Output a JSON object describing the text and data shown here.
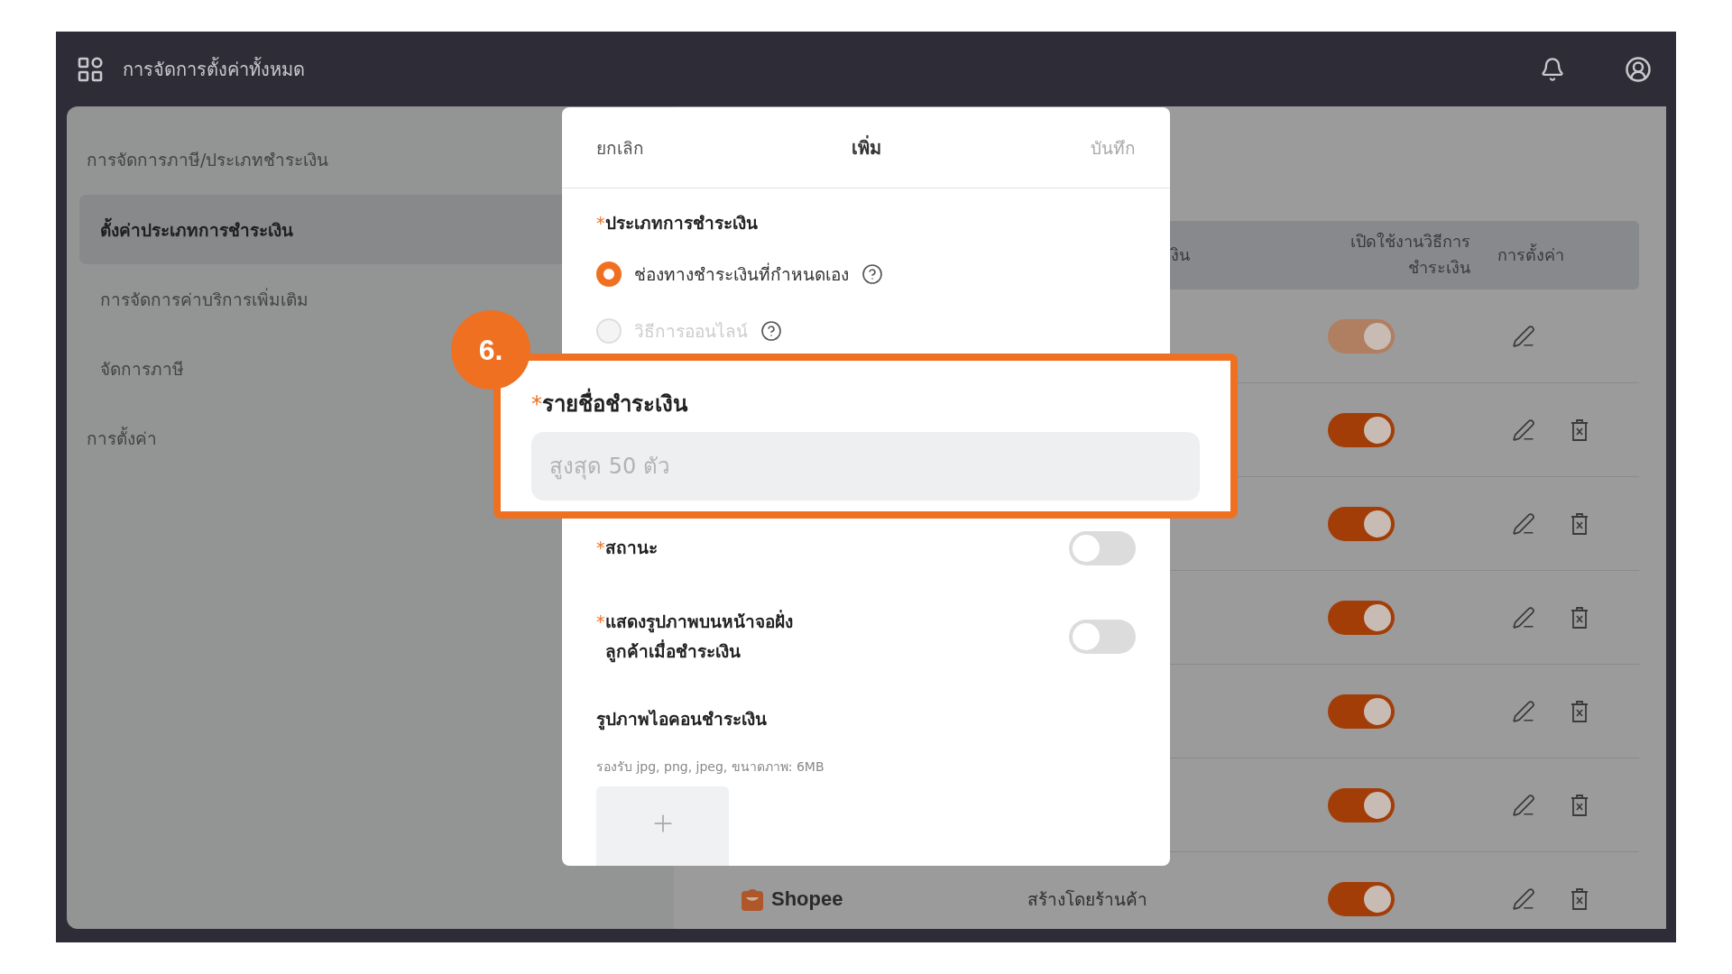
{
  "top_bar": {
    "title": "การจัดการตั้งค่าทั้งหมด"
  },
  "sidebar": {
    "groups": [
      {
        "label": "การจัดการภาษี/ประเภทชำระเงิน",
        "children": [
          {
            "label": "ตั้งค่าประเภทการชำระเงิน",
            "selected": true
          },
          {
            "label": "การจัดการค่าบริการเพิ่มเติม",
            "selected": false
          },
          {
            "label": "จัดการภาษี",
            "selected": false
          }
        ]
      },
      {
        "label": "การตั้งค่า"
      }
    ]
  },
  "table": {
    "columns": [
      {
        "label": "งิน"
      },
      {
        "label": "เปิดใช้งานวิธีการ ชำระเงิน"
      },
      {
        "label": "การตั้งค่า"
      }
    ],
    "rows": [
      {
        "enabled": true,
        "disabled": true,
        "deletable": false
      },
      {
        "enabled": true,
        "disabled": false,
        "deletable": true
      },
      {
        "enabled": true,
        "disabled": false,
        "deletable": true
      },
      {
        "enabled": true,
        "disabled": false,
        "deletable": true
      },
      {
        "enabled": true,
        "disabled": false,
        "deletable": true
      },
      {
        "enabled": true,
        "disabled": false,
        "deletable": true
      },
      {
        "name": "Shopee",
        "created_by": "สร้างโดยร้านค้า",
        "enabled": true,
        "disabled": false,
        "deletable": true
      }
    ]
  },
  "dialog": {
    "cancel": "ยกเลิก",
    "title": "เพิ่ม",
    "save": {
      "label": "บันทึก",
      "disabled": true
    },
    "payment_type": {
      "required_mark": "*",
      "label": "ประเภทการชำระเงิน",
      "options": [
        {
          "label": "ช่องทางชำระเงินที่กำหนดเอง",
          "selected": true,
          "disabled": false
        },
        {
          "label": "วิธีการออนไลน์",
          "selected": false,
          "disabled": true
        }
      ]
    },
    "switches": [
      {
        "required_mark": "*",
        "label": "สถานะ",
        "on": false
      },
      {
        "required_mark": "*",
        "label": "แสดงรูปภาพบนหน้าจอฝั่ง ลูกค้าเมื่อชำระเงิน",
        "on": false
      }
    ],
    "icon": {
      "label": "รูปภาพไอคอนชำระเงิน",
      "hint": "รองรับ jpg, png, jpeg, ขนาดภาพ: 6MB"
    }
  },
  "callout": {
    "step": "6.",
    "required_mark": "*",
    "label": "รายชื่อชำระเงิน",
    "placeholder": "สูงสุด 50 ตัว"
  }
}
